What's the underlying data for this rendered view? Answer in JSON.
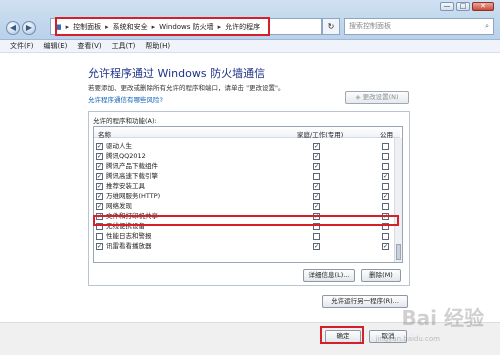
{
  "window": {
    "minimize": "—",
    "maximize": "□",
    "close": "✕"
  },
  "address": {
    "breadcrumbs": [
      "控制面板",
      "系统和安全",
      "Windows 防火墙",
      "允许的程序"
    ],
    "separator": "▸",
    "search_placeholder": "搜索控制面板"
  },
  "menu": [
    "文件(F)",
    "编辑(E)",
    "查看(V)",
    "工具(T)",
    "帮助(H)"
  ],
  "page": {
    "title": "允许程序通过 Windows 防火墙通信",
    "description": "若要添加、更改或删除所有允许的程序和端口，请单击 \"更改设置\"。",
    "risk_link": "允许程序通信有哪些风险?",
    "change_settings": "更改设置(N)"
  },
  "group": {
    "title": "允许的程序和功能(A):",
    "columns": {
      "name": "名称",
      "home": "家庭/工作(专用)",
      "public": "公用"
    },
    "rows": [
      {
        "name": "驱动人生",
        "on": true,
        "home": true,
        "public": false
      },
      {
        "name": "腾讯QQ2012",
        "on": true,
        "home": true,
        "public": false
      },
      {
        "name": "腾讯产品下载组件",
        "on": true,
        "home": true,
        "public": false
      },
      {
        "name": "腾讯高速下载引擎",
        "on": true,
        "home": false,
        "public": true
      },
      {
        "name": "推荐安装工具",
        "on": true,
        "home": true,
        "public": false
      },
      {
        "name": "万维网服务(HTTP)",
        "on": true,
        "home": true,
        "public": true
      },
      {
        "name": "网络发现",
        "on": true,
        "home": true,
        "public": false
      },
      {
        "name": "文件和打印机共享",
        "on": true,
        "home": true,
        "public": true
      },
      {
        "name": "无线便携设备",
        "on": false,
        "home": false,
        "public": false
      },
      {
        "name": "性能日志和警报",
        "on": false,
        "home": false,
        "public": false
      },
      {
        "name": "讯雷看看播放器",
        "on": true,
        "home": true,
        "public": true
      }
    ],
    "details_button": "详细信息(L)...",
    "remove_button": "删除(M)"
  },
  "allow_other": "允许运行另一程序(R)...",
  "footer": {
    "ok": "确定",
    "cancel": "取消"
  },
  "watermark": {
    "logo": "Bai 经验",
    "url": "jingyan.baidu.com"
  },
  "colors": {
    "highlight": "#d3202b",
    "title": "#1e3287",
    "link": "#0a5fb8"
  }
}
